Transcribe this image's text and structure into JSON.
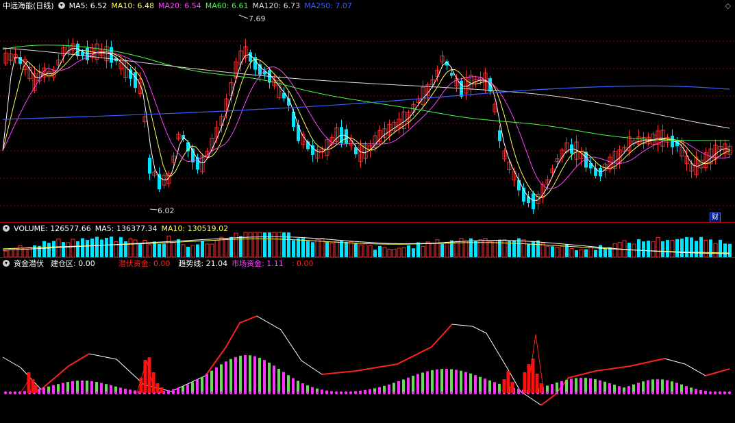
{
  "price_panel": {
    "title": "中远海能(日线)",
    "ma": [
      {
        "label": "MA5: 6.52",
        "color": "#ffffff"
      },
      {
        "label": "MA10: 6.48",
        "color": "#ffff55"
      },
      {
        "label": "MA20: 6.54",
        "color": "#ff44ff"
      },
      {
        "label": "MA60: 6.61",
        "color": "#44ff44"
      },
      {
        "label": "MA120: 6.73",
        "color": "#dddddd"
      },
      {
        "label": "MA250: 7.07",
        "color": "#3a5cff"
      }
    ],
    "high_label": "7.69",
    "low_label": "6.02",
    "cai_label": "财",
    "corner_icon": "◇"
  },
  "volume_panel": {
    "label": "VOLUME: 126577.66",
    "ma5": "MA5: 136377.34",
    "ma10": "MA10: 130519.02"
  },
  "indicator_panel": {
    "name": "资金潜伏",
    "items": [
      {
        "label": "建仓区: 0.00",
        "color": "#ffffff"
      },
      {
        "label": "潜伏资金: 0.00",
        "color": "#ff2020"
      },
      {
        "label": "趋势线: 21.04",
        "color": "#ffffff"
      },
      {
        "label": "市场资金: 1.11",
        "color": "#ff44ff"
      },
      {
        "label": ": 0.00",
        "color": "#ff2020"
      }
    ]
  },
  "colors": {
    "up": "#ff3030",
    "down": "#00e5ff",
    "grid": "#8b0000",
    "magenta": "#ff33ff",
    "green": "#66dd55"
  }
}
